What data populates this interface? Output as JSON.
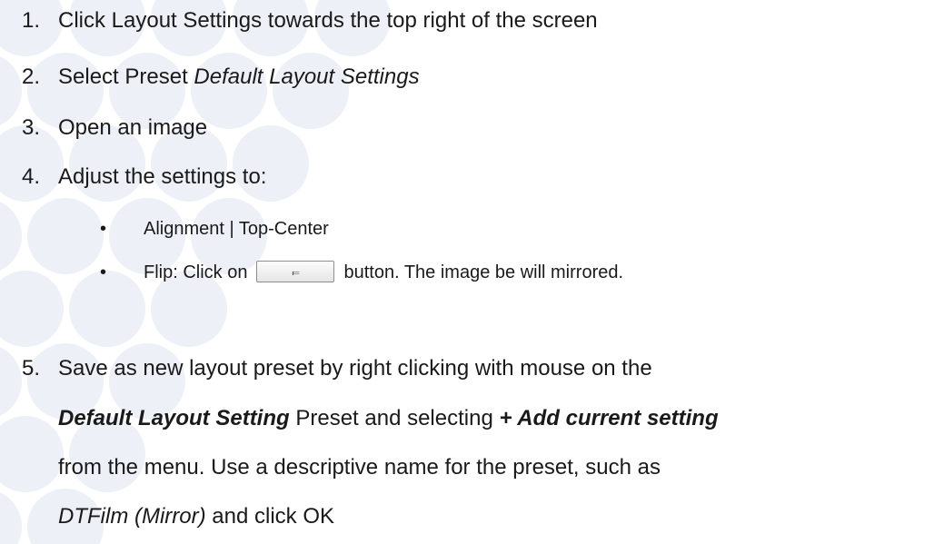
{
  "steps": [
    {
      "number": "1.",
      "text": "Click Layout Settings towards the top right of the screen"
    },
    {
      "number": "2.",
      "text_before": "Select Preset ",
      "text_italic": "Default Layout Settings"
    },
    {
      "number": "3.",
      "text": "Open an image"
    },
    {
      "number": "4.",
      "text": "Adjust the settings to:",
      "bullets": [
        {
          "symbol": "•",
          "text": "Alignment | Top-Center"
        },
        {
          "symbol": "•",
          "text_before": "Flip: Click on",
          "button_icon": "flip-horizontal-icon",
          "button_glyph": "⫭",
          "text_after": "button. The image be will mirrored."
        }
      ]
    },
    {
      "number": "5.",
      "line1": "Save as new layout preset by right clicking with mouse on the",
      "line2_bold_italic": "Default Layout Setting",
      "line2_mid": " Preset and selecting ",
      "line2_bold_italic_end": "+ Add current setting",
      "line3": "from the menu. Use a descriptive name for the preset, such as",
      "line4_italic": "DTFilm (Mirror)",
      "line4_rest": " and click OK"
    }
  ],
  "colors": {
    "text": "#1a1a1a",
    "background_circles": "#eef0f8"
  }
}
